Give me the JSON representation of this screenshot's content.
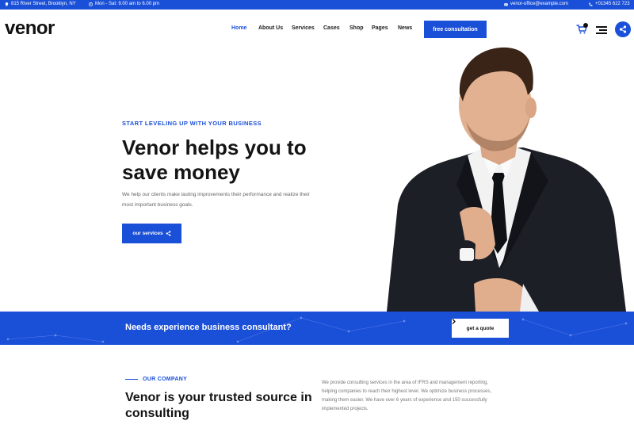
{
  "topbar": {
    "address": "815 River Street, Brooklyn, NY",
    "hours": "Mon - Sat: 9.00 am to 6.00 pm",
    "email": "venor-office@example.com",
    "phone": "+01345 622 723"
  },
  "header": {
    "logo": "venor",
    "nav": [
      "Home",
      "About Us",
      "Services",
      "Cases",
      "Shop",
      "Pages",
      "News"
    ],
    "cta": "free consultation",
    "cart_count": ""
  },
  "hero": {
    "kicker": "START LEVELING UP WITH YOUR BUSINESS",
    "title": "Venor helps you to save money",
    "description": "We help our clients make lasting improvements their performance and realize their most important business goals.",
    "button": "our services"
  },
  "strip": {
    "text": "Needs experience business consultant?",
    "button": "get a quote"
  },
  "company": {
    "kicker": "OUR COMPANY",
    "title": "Venor is your trusted source in consulting",
    "description": "We provide consulting services in the area of IFRS and management reporting, helping companies to reach their highest level. We optimize business processes, making them easier. We have over 6 years of experience and 150 successfully implemented projects."
  },
  "colors": {
    "accent": "#1a4fd8",
    "dark": "#141414"
  },
  "icons": [
    "location-icon",
    "clock-icon",
    "mail-icon",
    "phone-icon",
    "cart-icon",
    "menu-icon",
    "share-icon",
    "arrow-right-icon"
  ]
}
